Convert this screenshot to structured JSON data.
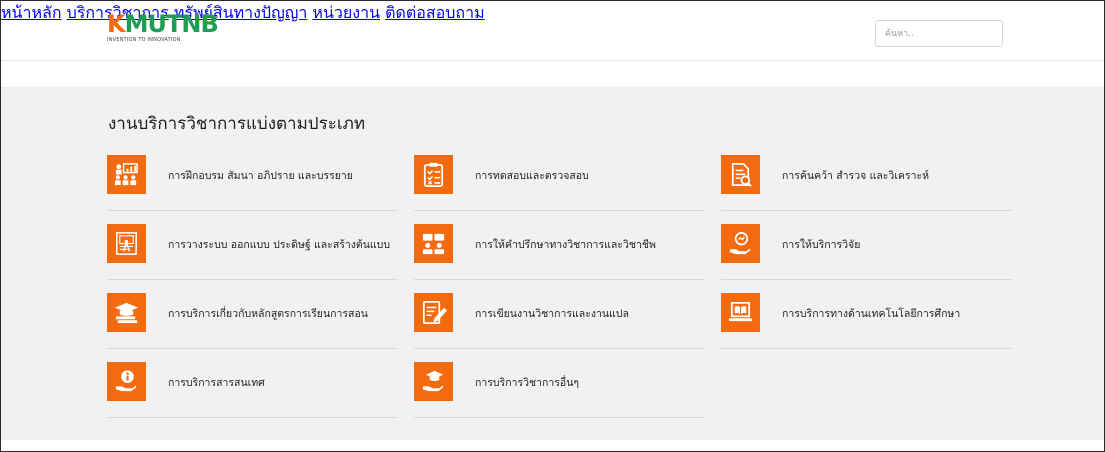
{
  "brand": {
    "logo_k": "K",
    "logo_rest": "MUTNB",
    "tagline": "INVENTION TO INNOVATION",
    "accent_color": "#f26b10",
    "logo_green": "#1f9d57"
  },
  "nav": {
    "items": [
      {
        "label": "หน้าหลัก"
      },
      {
        "label": "บริการวิชาการ"
      },
      {
        "label": "ทรัพย์สินทางปัญญา"
      },
      {
        "label": "หน่วยงาน"
      },
      {
        "label": "ติดต่อสอบถาม"
      }
    ]
  },
  "search": {
    "placeholder": "ค้นหา..",
    "value": ""
  },
  "section": {
    "title": "งานบริการวิชาการแบ่งตามประเภท"
  },
  "services": [
    {
      "label": "การฝึกอบรม สัมนา อภิปราย และบรรยาย",
      "icon": "training-icon"
    },
    {
      "label": "การทดสอบและตรวจสอบ",
      "icon": "clipboard-check-icon"
    },
    {
      "label": "การค้นคว้า สำรวจ และวิเคราะห์",
      "icon": "document-search-icon"
    },
    {
      "label": "การวางระบบ ออกแบบ ประดิษฐ์ และสร้างต้นแบบ",
      "icon": "blueprint-icon"
    },
    {
      "label": "การให้คำปรึกษาทางวิชาการและวิชาชีพ",
      "icon": "consulting-icon"
    },
    {
      "label": "การให้บริการวิจัย",
      "icon": "research-hand-icon"
    },
    {
      "label": "การบริการเกี่ยวกับหลักสูตรการเรียนการสอน",
      "icon": "graduation-books-icon"
    },
    {
      "label": "การเขียนงานวิชาการและงานแปล",
      "icon": "writing-icon"
    },
    {
      "label": "การบริการทางด้านเทคโนโลยีการศึกษา",
      "icon": "laptop-book-icon"
    },
    {
      "label": "การบริการสารสนเทศ",
      "icon": "info-hand-icon"
    },
    {
      "label": "การบริการวิชาการอื่นๆ",
      "icon": "graduation-hand-icon"
    }
  ]
}
